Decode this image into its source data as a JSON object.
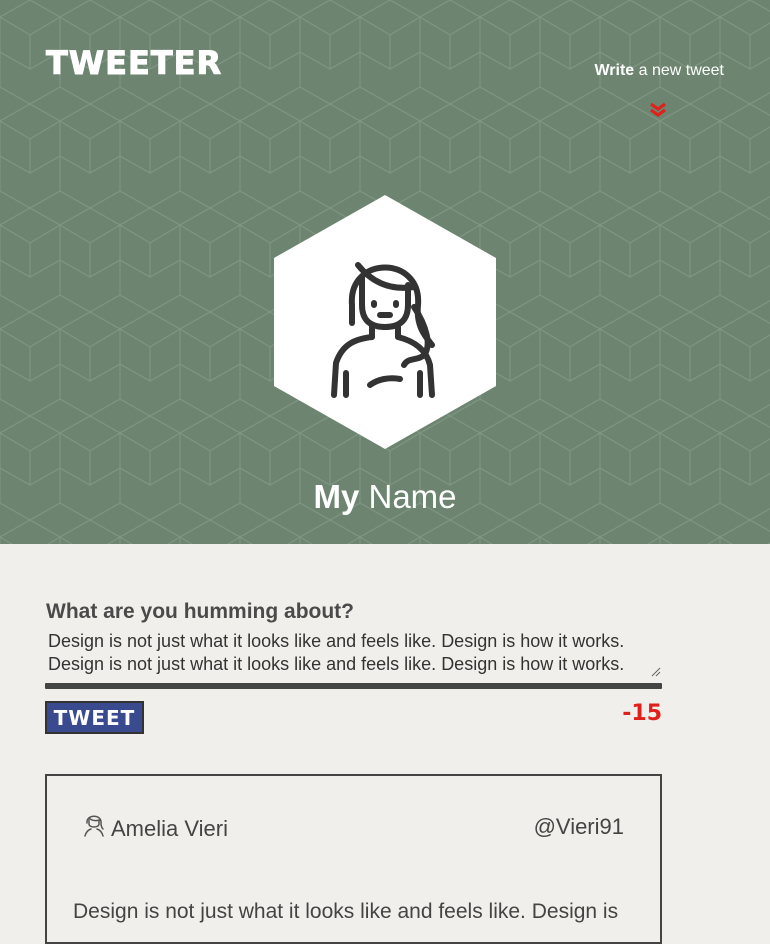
{
  "header": {
    "logo": "TWEETER",
    "write_bold": "Write",
    "write_rest": " a new tweet",
    "chevron_icon": "double-chevron-down-icon",
    "accent_color": "#e0201a",
    "bg_color": "#6c8470"
  },
  "profile": {
    "name_bold": "My",
    "name_rest": " Name",
    "avatar_icon": "woman-avatar-icon"
  },
  "composer": {
    "label": "What are you humming about?",
    "text": "Design is not just what it looks like and feels like. Design is how it works.\nDesign is not just what it looks like and feels like. Design is how it works.",
    "button_label": "TWEET",
    "counter": "-15"
  },
  "tweets": [
    {
      "author": "Amelia Vieri",
      "handle": "@Vieri91",
      "text": "Design is not just what it looks like and feels like. Design is",
      "avatar_icon": "woman-avatar-icon"
    }
  ]
}
